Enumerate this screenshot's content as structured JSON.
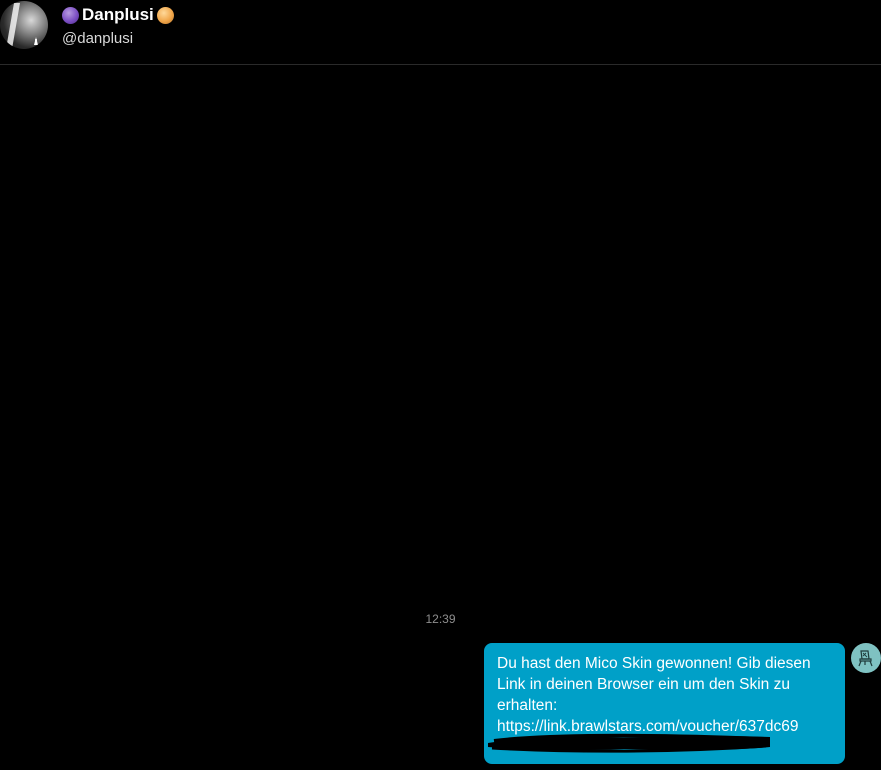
{
  "header": {
    "display_name": "Danplusi",
    "username": "@danplusi",
    "avatar_icon": "avatar-photo",
    "name_emoji_left": "purple-circle-icon",
    "name_emoji_right": "orange-moon-icon"
  },
  "conversation": {
    "timestamp": "12:39",
    "messages": [
      {
        "text": "Du hast den Mico Skin gewonnen! Gib diesen Link in deinen Browser ein um den Skin zu erhalten:\nhttps://link.brawlstars.com/voucher/637dc69",
        "redacted": true,
        "bubble_color": "#00a0c8",
        "sender_avatar_icon": "chair-icon"
      }
    ]
  },
  "colors": {
    "background": "#000000",
    "bubble": "#00a0c8",
    "sender_avatar_bg": "#7fc2c2"
  }
}
